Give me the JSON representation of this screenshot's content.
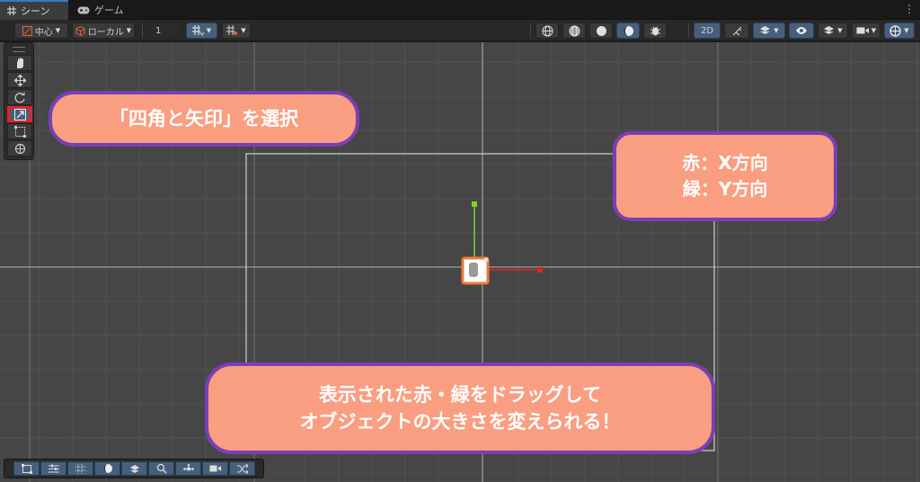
{
  "tabs": [
    {
      "label": "シーン",
      "icon": "grid-icon",
      "active": true
    },
    {
      "label": "ゲーム",
      "icon": "gamepad-icon",
      "active": false
    }
  ],
  "toolbar": {
    "pivot_label": "中心",
    "space_label": "ローカル",
    "grid_size_value": "1",
    "view_2d_label": "2D"
  },
  "tools": [
    {
      "name": "hand-tool",
      "icon": "hand-icon"
    },
    {
      "name": "move-tool",
      "icon": "move-arrows-icon"
    },
    {
      "name": "rotate-tool",
      "icon": "rotate-icon"
    },
    {
      "name": "scale-tool",
      "icon": "scale-icon",
      "selected": true
    },
    {
      "name": "rect-tool",
      "icon": "rect-transform-icon"
    },
    {
      "name": "transform-tool",
      "icon": "transform-icon"
    }
  ],
  "callouts": {
    "tool_hint": "「四角と矢印」を選択",
    "axis_red": "赤：X方向",
    "axis_green": "緑：Y方向",
    "drag_line1": "表示された赤・緑をドラッグして",
    "drag_line2": "オブジェクトの大きさを変えられる！"
  },
  "colors": {
    "callout_fill": "#f99e81",
    "callout_border": "#7a3fb5",
    "highlight_red": "#e8212b",
    "axis_x": "#e0262b",
    "axis_y": "#7cd621",
    "toolbar_blue": "#46607c"
  }
}
